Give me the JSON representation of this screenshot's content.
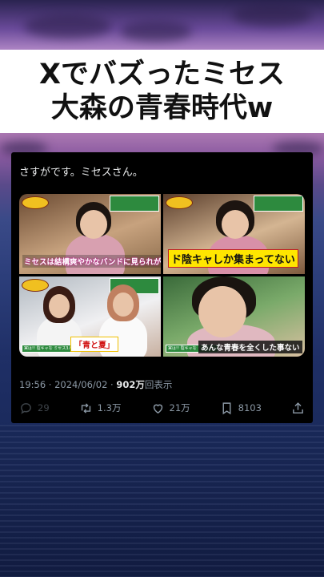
{
  "title": {
    "line1": "Xでバズったミセス",
    "line2": "大森の青春時代w"
  },
  "tweet": {
    "text": "さすがです。ミセスさん。",
    "images": [
      {
        "caption": "ミセスは結構爽やかなバンドに見られがち"
      },
      {
        "caption": "ド陰キャしか集まってない"
      },
      {
        "caption": "「青と夏」",
        "badge": "実は!! 陰キャな ミセス3人"
      },
      {
        "caption": "あんな青春を全くした事ない",
        "badge": "実は!! 陰キャな ミセス3人"
      }
    ],
    "timestamp": "19:56 · 2024/06/02 · ",
    "views_count": "902万",
    "views_label": "回表示",
    "actions": {
      "reply_count": "29",
      "retweet_count": "1.3万",
      "like_count": "21万",
      "bookmark_count": "8103"
    }
  }
}
